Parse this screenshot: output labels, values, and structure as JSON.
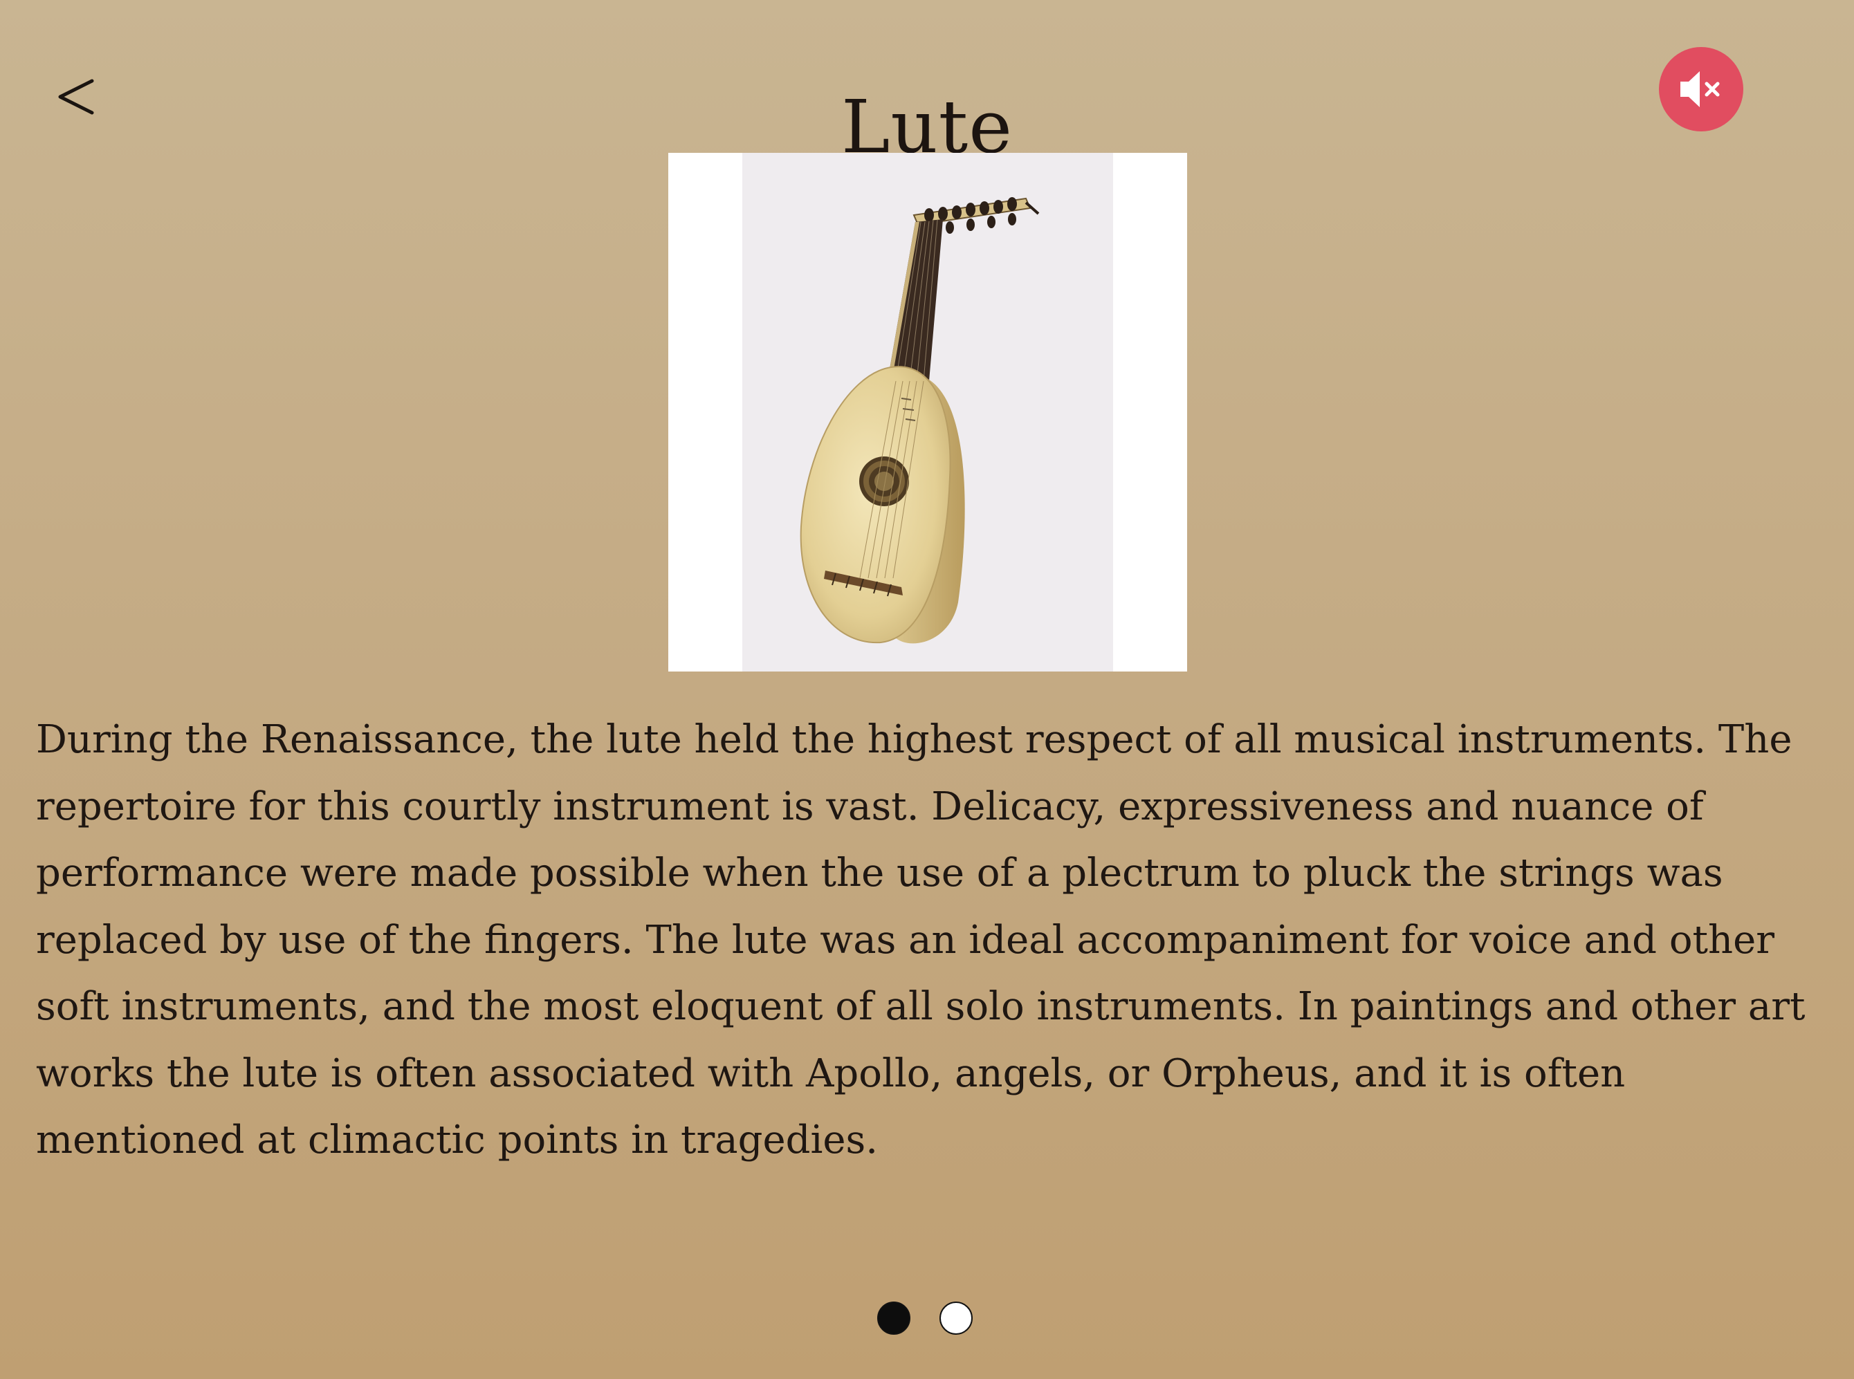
{
  "header": {
    "back_label": "<",
    "title": "Lute",
    "mute_icon": "speaker-muted-icon"
  },
  "instrument_image": {
    "alt": "Lute"
  },
  "description": "During the Renaissance, the lute held the highest respect of all musical instruments. The repertoire for this courtly instrument is vast. Delicacy, expressiveness and nuance of performance were made possible when the use of a plectrum to pluck the strings was replaced by use of the fingers. The lute was an ideal accompaniment for voice and other soft instruments, and the most eloquent of all solo instruments. In paintings and other art works the lute is often associated with Apollo, angels, or Orpheus, and it is often mentioned at climactic points in tragedies.",
  "pager": {
    "total": 2,
    "current": 1
  },
  "colors": {
    "background_top": "#c9b592",
    "background_bottom": "#bf9f72",
    "mute_button": "#e14d60",
    "text": "#1c1410"
  }
}
